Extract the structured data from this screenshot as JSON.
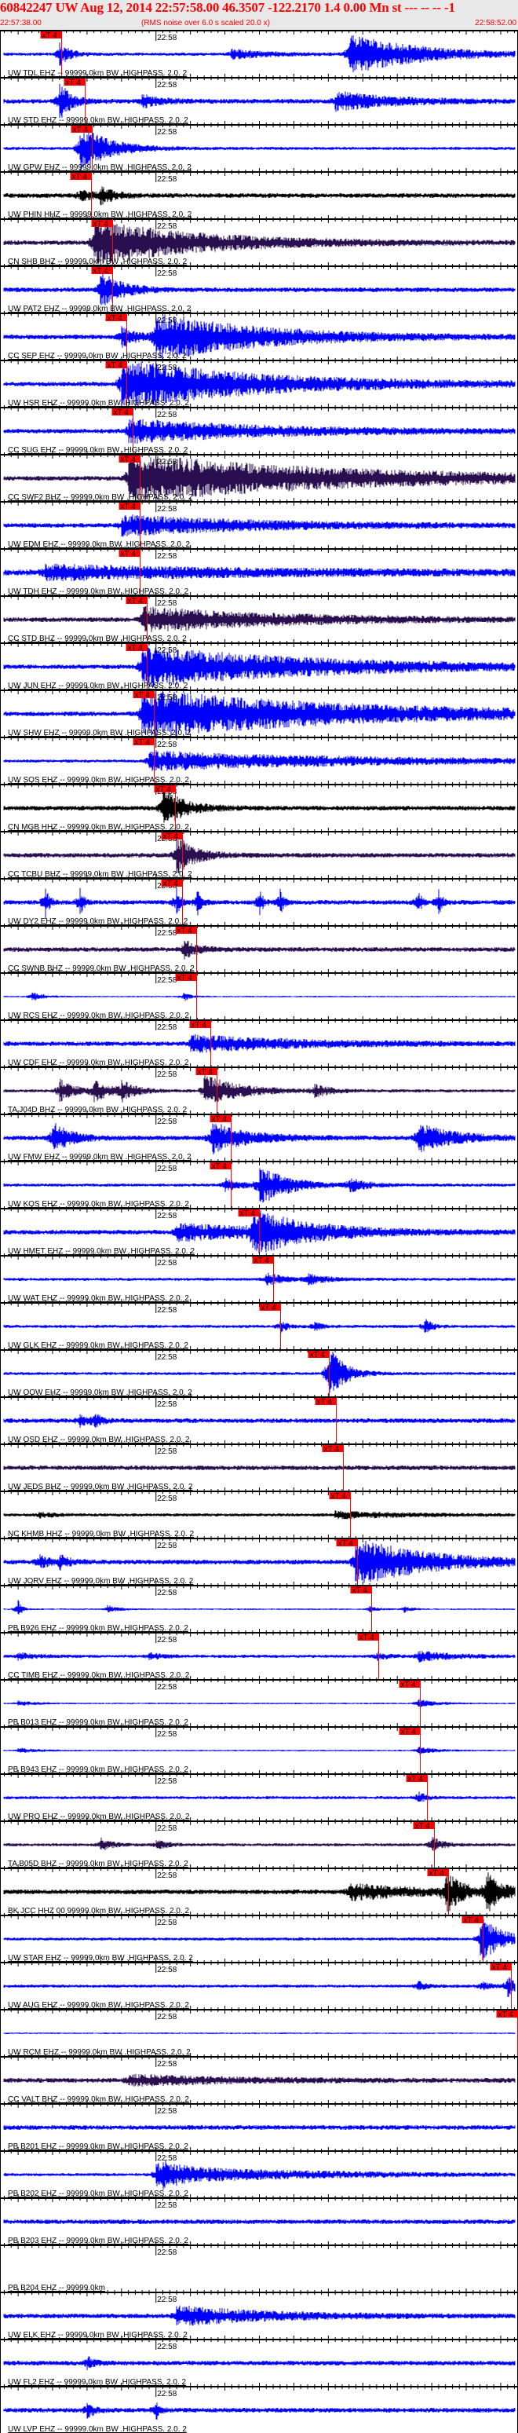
{
  "header": {
    "title": "60842247 UW Aug 12, 2014 22:57:58.00   46.3507 -122.2170  1.4 0.00 Mn st --- -- --  -1",
    "start_time": "22:57:38.00",
    "note": "(RMS noise over 6.0 s scaled 20.0 x)",
    "end_time": "22:58:52.00"
  },
  "chart_data": {
    "type": "line",
    "title": "60842247 UW Aug 12, 2014 22:57:58.00",
    "x_unit": "seconds after 22:57:38.00",
    "xlim": [
      0,
      74
    ],
    "minute_tick_label": "22:58",
    "minute_tick_s": 22,
    "pick_label": "xT 4",
    "colors": {
      "EHZ": "#0000ff",
      "BHZ": "#2a0f50",
      "HHZ": "#000000",
      "pick": "#ff0000",
      "axis": "#000000"
    },
    "traces": [
      {
        "label": "UW TDL EHZ -- 99999.0km BW .HIGHPASS. 2.0. 2",
        "chan": "EHZ",
        "pick_s": 8.3
      },
      {
        "label": "UW STD EHZ -- 99999.0km BW .HIGHPASS. 2.0. 2",
        "chan": "EHZ",
        "pick_s": 11.7
      },
      {
        "label": "UW GPW EHZ -- 99999.0km BW .HIGHPASS. 2.0. 2",
        "chan": "EHZ",
        "pick_s": 12.8
      },
      {
        "label": "UW PHIN HHZ -- 99999.0km BW .HIGHPASS. 2.0. 2",
        "chan": "HHZ",
        "pick_s": 12.6
      },
      {
        "label": "CN SHB BHZ -- 99999.0km BW .HIGHPASS. 2.0. 2",
        "chan": "BHZ",
        "pick_s": 15.7
      },
      {
        "label": "UW PAT2 EHZ -- 99999.0km BW .HIGHPASS. 2.0. 2",
        "chan": "EHZ",
        "pick_s": 15.7
      },
      {
        "label": "CC SEP EHZ -- 99999.0km BW .HIGHPASS. 2.0. 2",
        "chan": "EHZ",
        "pick_s": 17.8
      },
      {
        "label": "UW HSR EHZ -- 99999.0km BW .HIGHPASS. 2.0. 2",
        "chan": "EHZ",
        "pick_s": 17.8
      },
      {
        "label": "CC SUG EHZ -- 99999.0km BW .HIGHPASS. 2.0. 2",
        "chan": "EHZ",
        "pick_s": 18.7
      },
      {
        "label": "CC SWF2 BHZ -- 99999.0km BW .HIGHPASS. 2.0. 2",
        "chan": "BHZ",
        "pick_s": 19.7
      },
      {
        "label": "UW EDM EHZ -- 99999.0km BW .HIGHPASS. 2.0. 2",
        "chan": "EHZ",
        "pick_s": 19.7
      },
      {
        "label": "UW TDH EHZ -- 99999.0km BW .HIGHPASS. 2.0. 2",
        "chan": "EHZ",
        "pick_s": 19.7
      },
      {
        "label": "CC STD BHZ -- 99999.0km BW .HIGHPASS. 2.0. 2",
        "chan": "BHZ",
        "pick_s": 20.7
      },
      {
        "label": "UW JUN EHZ -- 99999.0km BW .HIGHPASS. 2.0. 2",
        "chan": "EHZ",
        "pick_s": 20.7
      },
      {
        "label": "UW SHW EHZ -- 99999.0km BW .HIGHPASS. 2.0. 2",
        "chan": "EHZ",
        "pick_s": 21.7
      },
      {
        "label": "UW SOS EHZ -- 99999.0km BW .HIGHPASS. 2.0. 2",
        "chan": "EHZ",
        "pick_s": 21.7
      },
      {
        "label": "CN MGB HHZ -- 99999.0km BW .HIGHPASS. 2.0. 2",
        "chan": "HHZ",
        "pick_s": 24.8
      },
      {
        "label": "CC TCBU BHZ -- 99999.0km BW .HIGHPASS. 2.0. 2",
        "chan": "BHZ",
        "pick_s": 25.8
      },
      {
        "label": "UW DY2 EHZ -- 99999.0km BW .HIGHPASS. 2.0. 2",
        "chan": "EHZ",
        "pick_s": 25.8
      },
      {
        "label": "CC SWNB BHZ -- 99999.0km BW .HIGHPASS. 2.0. 2",
        "chan": "BHZ",
        "pick_s": 27.9
      },
      {
        "label": "UW RCS EHZ -- 99999.0km BW .HIGHPASS. 2.0. 2",
        "chan": "EHZ",
        "pick_s": 27.9
      },
      {
        "label": "UW CDF EHZ -- 99999.0km BW .HIGHPASS. 2.0. 2",
        "chan": "EHZ",
        "pick_s": 29.9
      },
      {
        "label": "TA J04D BHZ -- 99999.0km BW .HIGHPASS. 2.0. 2",
        "chan": "BHZ",
        "pick_s": 30.9
      },
      {
        "label": "UW FMW EHZ -- 99999.0km BW .HIGHPASS. 2.0. 2",
        "chan": "EHZ",
        "pick_s": 32.9
      },
      {
        "label": "UW KOS EHZ -- 99999.0km BW .HIGHPASS. 2.0. 2",
        "chan": "EHZ",
        "pick_s": 32.9
      },
      {
        "label": "UW HMET EHZ -- 99999.0km BW .HIGHPASS. 2.0. 2",
        "chan": "EHZ",
        "pick_s": 37.0
      },
      {
        "label": "UW WAT EHZ -- 99999.0km BW .HIGHPASS. 2.0. 2",
        "chan": "EHZ",
        "pick_s": 39.0
      },
      {
        "label": "UW GLK EHZ -- 99999.0km BW .HIGHPASS. 2.0. 2",
        "chan": "EHZ",
        "pick_s": 40.1
      },
      {
        "label": "UW OOW EHZ -- 99999.0km BW .HIGHPASS. 2.0. 2",
        "chan": "EHZ",
        "pick_s": 47.1
      },
      {
        "label": "UW OSD EHZ -- 99999.0km BW .HIGHPASS. 2.0. 2",
        "chan": "EHZ",
        "pick_s": 48.2
      },
      {
        "label": "UW JEDS BHZ -- 99999.0km BW .HIGHPASS. 2.0. 2",
        "chan": "BHZ",
        "pick_s": 49.2
      },
      {
        "label": "NC KHMB HHZ -- 99999.0km BW .HIGHPASS. 2.0. 2",
        "chan": "HHZ",
        "pick_s": 50.2
      },
      {
        "label": "UW JORV EHZ -- 99999.0km BW .HIGHPASS. 2.0. 2",
        "chan": "EHZ",
        "pick_s": 51.2
      },
      {
        "label": "PB B926 EHZ -- 99999.0km BW .HIGHPASS. 2.0. 2",
        "chan": "EHZ",
        "pick_s": 53.3
      },
      {
        "label": "CC TIMB EHZ -- 99999.0km BW .HIGHPASS. 2.0. 2",
        "chan": "EHZ",
        "pick_s": 54.3
      },
      {
        "label": "PB B013 EHZ -- 99999.0km BW .HIGHPASS. 2.0. 2",
        "chan": "EHZ",
        "pick_s": 60.3
      },
      {
        "label": "PB B943 EHZ -- 99999.0km BW .HIGHPASS. 2.0. 2",
        "chan": "EHZ",
        "pick_s": 60.3
      },
      {
        "label": "UW PRO EHZ -- 99999.0km BW .HIGHPASS. 2.0. 2",
        "chan": "EHZ",
        "pick_s": 61.4
      },
      {
        "label": "TA B05D BHZ -- 99999.0km BW .HIGHPASS. 2.0. 2",
        "chan": "BHZ",
        "pick_s": 62.4
      },
      {
        "label": "BK JCC HHZ 00 99999.0km BW .HIGHPASS. 2.0. 2",
        "chan": "HHZ",
        "pick_s": 64.4
      },
      {
        "label": "UW STAR EHZ -- 99999.0km BW .HIGHPASS. 2.0. 2",
        "chan": "EHZ",
        "pick_s": 69.4
      },
      {
        "label": "UW AUG EHZ -- 99999.0km BW .HIGHPASS. 2.0. 2",
        "chan": "EHZ",
        "pick_s": 73.5
      },
      {
        "label": "UW RCM EHZ -- 99999.0km BW .HIGHPASS. 2.0. 2",
        "chan": "EHZ",
        "pick_s": 74.5
      },
      {
        "label": "CC VALT BHZ -- 99999.0km BW .HIGHPASS. 2.0. 2",
        "chan": "BHZ",
        "pick_s": null
      },
      {
        "label": "PB B201 EHZ -- 99999.0km BW .HIGHPASS. 2.0. 2",
        "chan": "EHZ",
        "pick_s": null
      },
      {
        "label": "PB B202 EHZ -- 99999.0km BW .HIGHPASS. 2.0. 2",
        "chan": "EHZ",
        "pick_s": null
      },
      {
        "label": "PB B203 EHZ -- 99999.0km BW .HIGHPASS. 2.0. 2",
        "chan": "EHZ",
        "pick_s": null
      },
      {
        "label": "PB B204 EHZ -- 99999.0km",
        "chan": "EHZ",
        "pick_s": null
      },
      {
        "label": "UW ELK EHZ -- 99999.0km BW .HIGHPASS. 2.0. 2",
        "chan": "EHZ",
        "pick_s": null
      },
      {
        "label": "UW FL2 EHZ -- 99999.0km BW .HIGHPASS. 2.0. 2",
        "chan": "EHZ",
        "pick_s": null
      },
      {
        "label": "UW LVP EHZ -- 99999.0km BW .HIGHPASS. 2.0. 2",
        "chan": "EHZ",
        "pick_s": null
      }
    ]
  }
}
